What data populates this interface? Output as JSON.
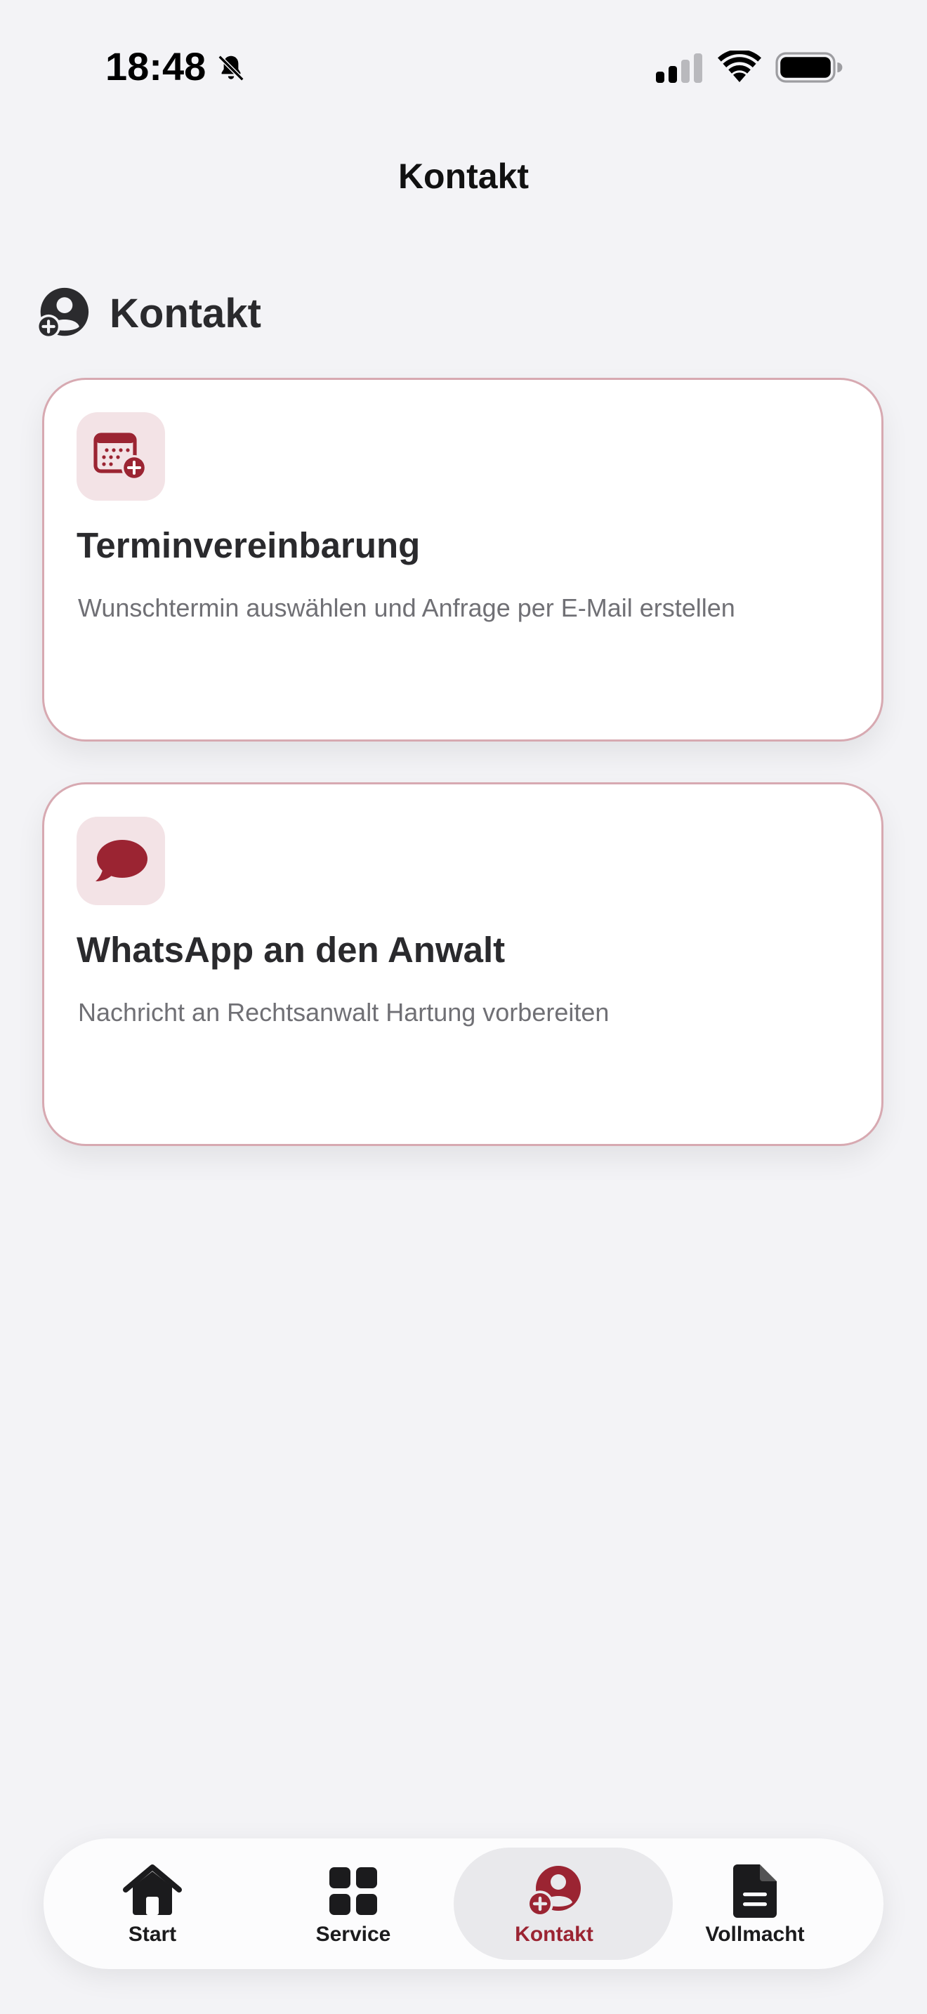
{
  "status_bar": {
    "time": "18:48",
    "icons": [
      "bell-slash-icon",
      "cellular-signal-icon",
      "wifi-icon",
      "battery-icon"
    ]
  },
  "nav": {
    "title": "Kontakt"
  },
  "section": {
    "icon": "person-add-icon",
    "title": "Kontakt"
  },
  "cards": [
    {
      "icon": "calendar-add-icon",
      "title": "Terminvereinbarung",
      "description": "Wunschtermin auswählen und Anfrage per E-Mail erstellen"
    },
    {
      "icon": "chat-bubble-icon",
      "title": "WhatsApp an den Anwalt",
      "description": "Nachricht an Rechtsanwalt Hartung vorbereiten"
    }
  ],
  "tab_bar": {
    "active": "Kontakt",
    "tabs": [
      {
        "label": "Start",
        "icon": "house-icon"
      },
      {
        "label": "Service",
        "icon": "grid-icon"
      },
      {
        "label": "Kontakt",
        "icon": "person-add-icon"
      },
      {
        "label": "Vollmacht",
        "icon": "document-icon"
      }
    ]
  },
  "colors": {
    "accent": "#9b2432",
    "icon_background": "#f3e3e6",
    "card_border": "#d7a9b1",
    "page_background": "#f3f3f6"
  }
}
